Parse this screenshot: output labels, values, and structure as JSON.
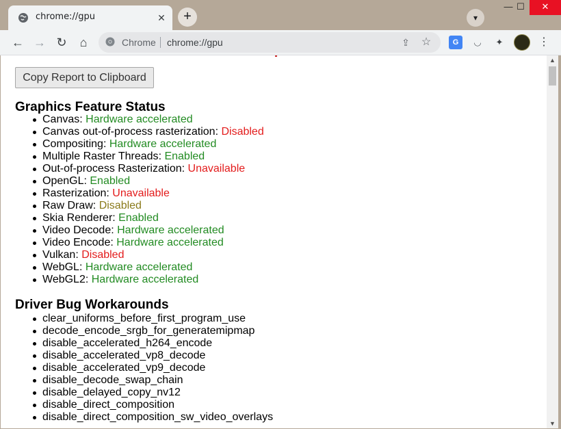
{
  "browser": {
    "tab_title": "chrome://gpu",
    "omnibox_chip": "Chrome",
    "url": "chrome://gpu",
    "translate_badge": "G"
  },
  "page": {
    "copy_button": "Copy Report to Clipboard",
    "feature_status_title": "Graphics Feature Status",
    "features": [
      {
        "name": "Canvas",
        "value": "Hardware accelerated",
        "status": "good"
      },
      {
        "name": "Canvas out-of-process rasterization",
        "value": "Disabled",
        "status": "bad"
      },
      {
        "name": "Compositing",
        "value": "Hardware accelerated",
        "status": "good"
      },
      {
        "name": "Multiple Raster Threads",
        "value": "Enabled",
        "status": "good"
      },
      {
        "name": "Out-of-process Rasterization",
        "value": "Unavailable",
        "status": "bad"
      },
      {
        "name": "OpenGL",
        "value": "Enabled",
        "status": "good"
      },
      {
        "name": "Rasterization",
        "value": "Unavailable",
        "status": "bad"
      },
      {
        "name": "Raw Draw",
        "value": "Disabled",
        "status": "warn"
      },
      {
        "name": "Skia Renderer",
        "value": "Enabled",
        "status": "good"
      },
      {
        "name": "Video Decode",
        "value": "Hardware accelerated",
        "status": "good"
      },
      {
        "name": "Video Encode",
        "value": "Hardware accelerated",
        "status": "good"
      },
      {
        "name": "Vulkan",
        "value": "Disabled",
        "status": "bad"
      },
      {
        "name": "WebGL",
        "value": "Hardware accelerated",
        "status": "good"
      },
      {
        "name": "WebGL2",
        "value": "Hardware accelerated",
        "status": "good"
      }
    ],
    "workarounds_title": "Driver Bug Workarounds",
    "workarounds": [
      "clear_uniforms_before_first_program_use",
      "decode_encode_srgb_for_generatemipmap",
      "disable_accelerated_h264_encode",
      "disable_accelerated_vp8_decode",
      "disable_accelerated_vp9_decode",
      "disable_decode_swap_chain",
      "disable_delayed_copy_nv12",
      "disable_direct_composition",
      "disable_direct_composition_sw_video_overlays"
    ]
  },
  "colors": {
    "good": "#228b22",
    "bad": "#e31b1b",
    "warn": "#8a7a1a",
    "frame": "#b5a898",
    "close_button": "#e81123"
  },
  "icons": {
    "tab_favicon": "globe-icon",
    "tab_close": "close-icon",
    "new_tab": "plus-icon",
    "tab_search": "chevron-down-icon",
    "back": "arrow-left-icon",
    "forward": "arrow-right-icon",
    "reload": "reload-icon",
    "home": "home-icon",
    "share": "share-icon",
    "bookmark": "star-icon",
    "extensions": "puzzle-icon",
    "menu": "kebab-menu-icon"
  }
}
